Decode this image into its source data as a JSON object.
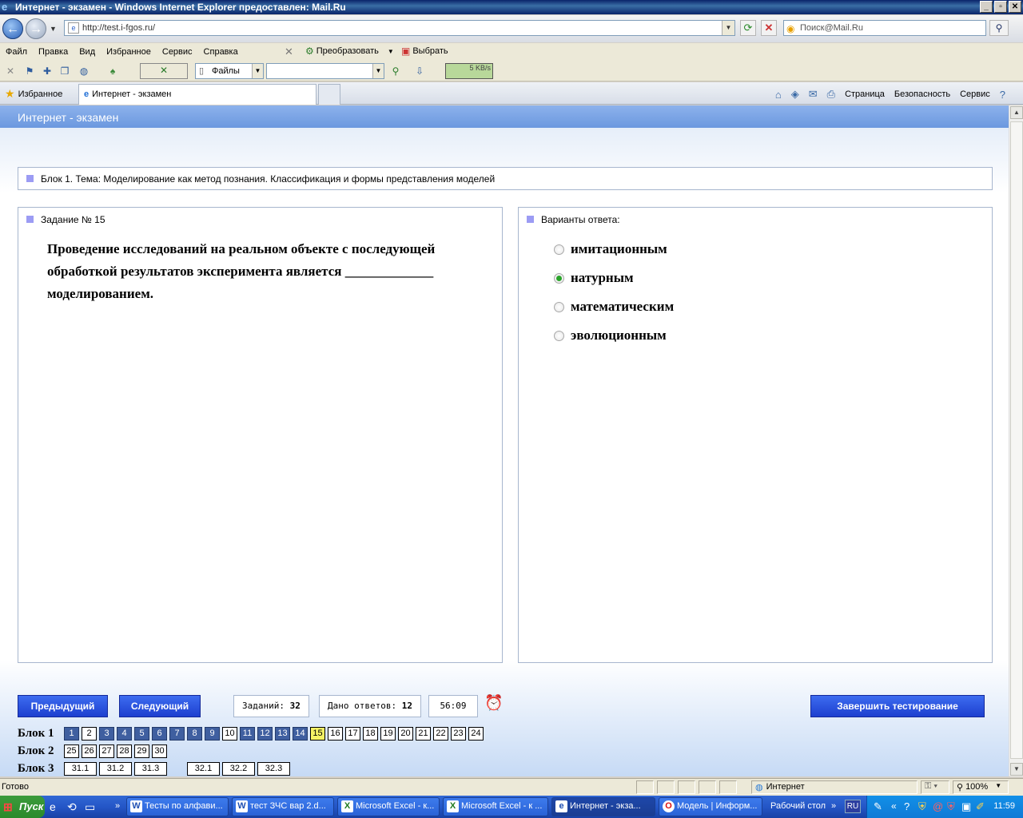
{
  "window": {
    "title": "Интернет - экзамен - Windows Internet Explorer предоставлен: Mail.Ru",
    "min": "_",
    "max": "▫",
    "close": "✕"
  },
  "address": {
    "url": "http://test.i-fgos.ru/",
    "search_placeholder": "Поиск@Mail.Ru"
  },
  "menu": [
    "Файл",
    "Правка",
    "Вид",
    "Избранное",
    "Сервис",
    "Справка"
  ],
  "toolbar": {
    "convert": "Преобразовать",
    "select": "Выбрать",
    "files": "Файлы",
    "speed": "5 KB/s"
  },
  "tabs": {
    "favorites": "Избранное",
    "active_tab": "Интернет - экзамен",
    "commands": {
      "page": "Страница",
      "safety": "Безопасность",
      "service": "Сервис"
    }
  },
  "page": {
    "header": "Интернет - экзамен",
    "topic": "Блок 1. Тема: Моделирование как метод познания. Классификация и формы представления моделей",
    "question_number": "Задание № 15",
    "question_text": "Проведение исследований на реальном объекте с последующей обработкой результатов эксперимента является _____________ моделированием.",
    "answers_label": "Варианты ответа:",
    "options": [
      {
        "label": "имитационным",
        "checked": false
      },
      {
        "label": "натурным",
        "checked": true
      },
      {
        "label": "математическим",
        "checked": false
      },
      {
        "label": "эволюционным",
        "checked": false
      }
    ],
    "prev_button": "Предыдущий",
    "next_button": "Следующий",
    "tasks_label": "Заданий:",
    "tasks_count": "32",
    "answers_given_label": "Дано ответов:",
    "answers_given_count": "12",
    "timer": "56:09",
    "finish_button": "Завершить тестирование",
    "blocks": [
      {
        "label": "Блок 1",
        "items": [
          "1",
          "2",
          "3",
          "4",
          "5",
          "6",
          "7",
          "8",
          "9",
          "10",
          "11",
          "12",
          "13",
          "14",
          "15",
          "16",
          "17",
          "18",
          "19",
          "20",
          "21",
          "22",
          "23",
          "24"
        ],
        "answered": [
          "1",
          "3",
          "4",
          "5",
          "6",
          "7",
          "8",
          "9",
          "11",
          "12",
          "13",
          "14"
        ],
        "current": "15"
      },
      {
        "label": "Блок 2",
        "items": [
          "25",
          "26",
          "27",
          "28",
          "29",
          "30"
        ],
        "answered": [],
        "current": ""
      },
      {
        "label": "Блок 3",
        "items": [
          "31.1",
          "31.2",
          "31.3",
          "32.1",
          "32.2",
          "32.3"
        ],
        "answered": [],
        "current": ""
      }
    ]
  },
  "status": {
    "text": "Готово",
    "zone": "Интернет",
    "zoom": "100%"
  },
  "taskbar": {
    "start": "Пуск",
    "tasks": [
      "Тесты по алфави...",
      "тест ЗЧС вар 2.d...",
      "Microsoft Excel - к...",
      "Microsoft Excel - к ...",
      "Интернет - экза...",
      "Модель | Информ..."
    ],
    "desktop": "Рабочий стол",
    "lang": "RU",
    "clock": "11:59"
  },
  "colors": {
    "answered_cell": "#3f5fa0",
    "current_cell": "#f5f264",
    "button_blue": "#1d3fcf",
    "header_blue": "#6b98df"
  }
}
